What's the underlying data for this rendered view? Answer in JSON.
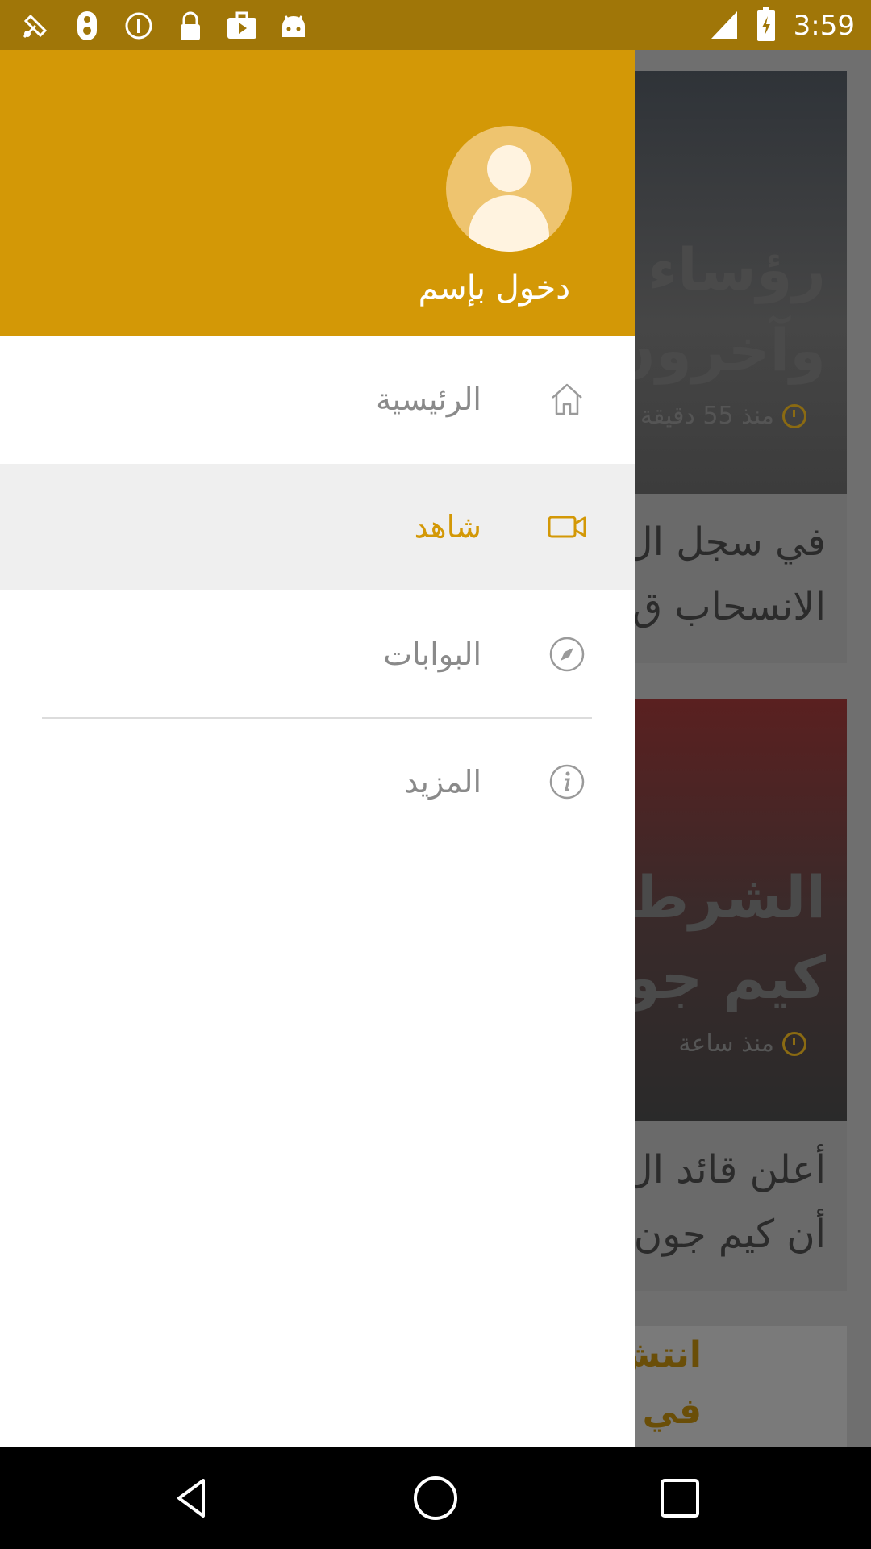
{
  "status_bar": {
    "time": "3:59",
    "left_icons": [
      "fake-gps-icon",
      "notification-icon",
      "info-circle-icon",
      "lock-icon",
      "briefcase-play-icon",
      "android-icon"
    ],
    "right_icons": [
      "signal-icon",
      "battery-icon"
    ],
    "color": "#a07608"
  },
  "drawer": {
    "header_color": "#d39806",
    "login_label": "دخول بإسم",
    "items": [
      {
        "label": "الرئيسية",
        "icon": "home-icon",
        "active": false
      },
      {
        "label": "شاهد",
        "icon": "video-camera-icon",
        "active": true
      },
      {
        "label": "البوابات",
        "icon": "compass-icon",
        "active": false
      },
      {
        "label": "المزيد",
        "icon": "info-icon",
        "active": false
      }
    ]
  },
  "feed": {
    "cards": [
      {
        "headline_line1": "رؤساء د",
        "headline_line2": "وآخرون",
        "time": "منذ 55 دقيقة"
      },
      {
        "text_line1": "في سجل ال",
        "text_line2": "الانسحاب ق"
      },
      {
        "headline_line1": "الشرطة",
        "headline_line2": "كيم جو",
        "time": "منذ ساعة"
      },
      {
        "text_line1": "أعلن قائد ال",
        "text_line2": "أن كيم جون"
      },
      {
        "headline_line1": "انتش",
        "headline_line2": "في"
      }
    ]
  },
  "nav_bar": {
    "buttons": [
      "back-icon",
      "home-icon",
      "recents-icon"
    ]
  }
}
